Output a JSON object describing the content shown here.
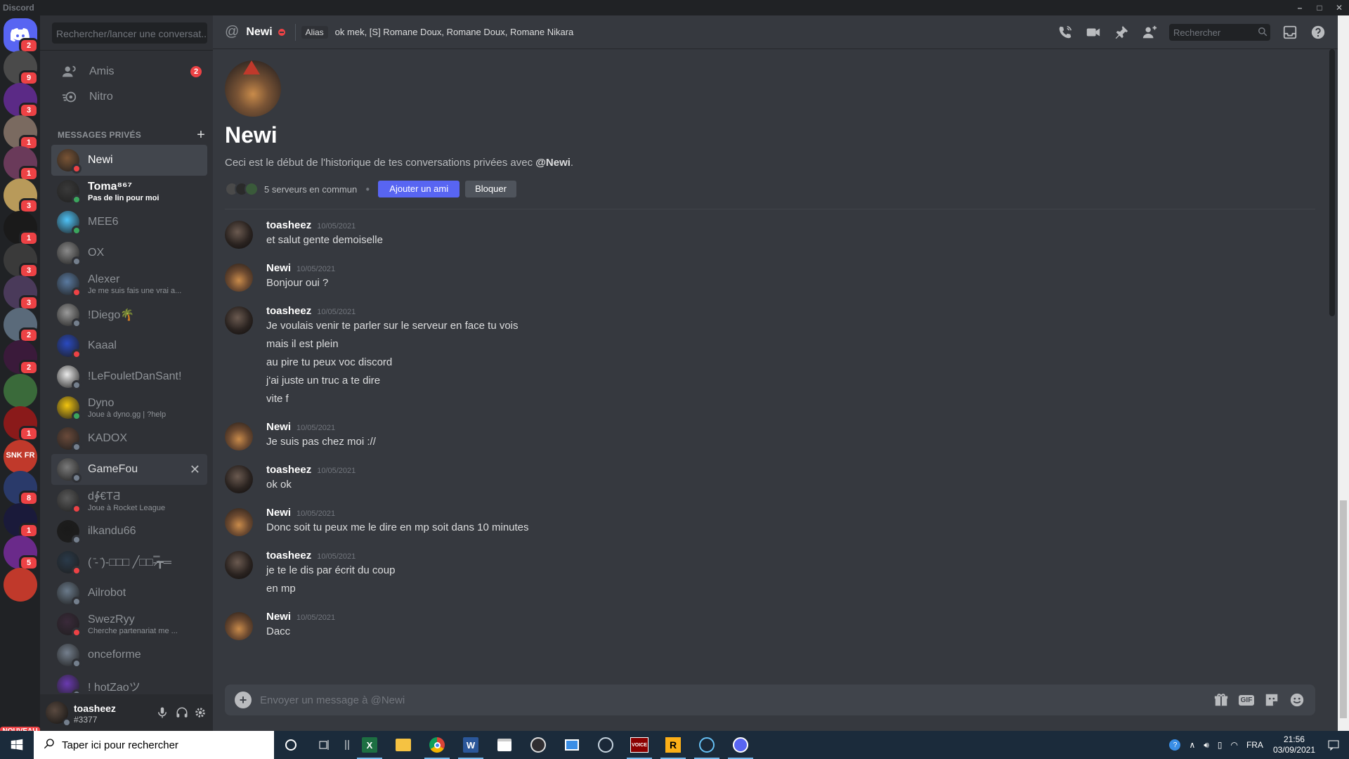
{
  "window": {
    "title": "Discord"
  },
  "servers": [
    {
      "name": "home",
      "badge": "2",
      "color": "#5865f2"
    },
    {
      "name": "server-1",
      "badge": "9",
      "color": "#4a4a4a"
    },
    {
      "name": "server-2",
      "badge": "3",
      "color": "#5b2a86"
    },
    {
      "name": "server-3",
      "badge": "1",
      "color": "#7a6a60"
    },
    {
      "name": "server-4",
      "badge": "1",
      "color": "#6a3a5a"
    },
    {
      "name": "server-5",
      "badge": "3",
      "color": "#b89a5a"
    },
    {
      "name": "server-6",
      "badge": "1",
      "color": "#1a1a1a"
    },
    {
      "name": "server-7",
      "badge": "3",
      "color": "#3a3a3a"
    },
    {
      "name": "server-8",
      "badge": "3",
      "color": "#4a3a5a"
    },
    {
      "name": "server-9",
      "badge": "2",
      "color": "#5a6a7a"
    },
    {
      "name": "server-10",
      "badge": "2",
      "color": "#3a1a3a"
    },
    {
      "name": "server-11",
      "badge": "",
      "color": "#3a6a3a"
    },
    {
      "name": "server-12",
      "badge": "1",
      "color": "#8a1a1a"
    },
    {
      "name": "server-13",
      "badge": "",
      "color": "#c0392b",
      "label": "SNK FR"
    },
    {
      "name": "server-14",
      "badge": "8",
      "color": "#2a3a6a"
    },
    {
      "name": "server-15",
      "badge": "1",
      "color": "#1a1a3a"
    },
    {
      "name": "server-16",
      "badge": "5",
      "color": "#6a2a8a"
    },
    {
      "name": "server-17",
      "badge": "",
      "color": "#c0392b"
    }
  ],
  "new_label": "NOUVEAU",
  "sidebar": {
    "search_placeholder": "Rechercher/lancer une conversat...",
    "friends": {
      "label": "Amis",
      "count": "2"
    },
    "nitro": {
      "label": "Nitro"
    },
    "dm_header": "MESSAGES PRIVÉS",
    "dms": [
      {
        "name": "Newi",
        "sub": "",
        "status": "dnd",
        "color": "#7a5435",
        "active": true
      },
      {
        "name": "Toma⁸⁶⁷",
        "sub": "Pas de lin pour moi",
        "status": "online",
        "color": "#3a3a3a",
        "bold": true
      },
      {
        "name": "MEE6",
        "sub": "",
        "status": "online",
        "color": "#4fc3f7"
      },
      {
        "name": "OX",
        "sub": "",
        "status": "offline",
        "color": "#8a8a8a"
      },
      {
        "name": "Alexer",
        "sub": "Je me suis fais une vrai a...",
        "status": "dnd",
        "color": "#5a7aa0"
      },
      {
        "name": "!Diego🌴",
        "sub": "",
        "status": "offline",
        "color": "#9a9a9a"
      },
      {
        "name": "Kaaal",
        "sub": "",
        "status": "dnd",
        "color": "#2a4ac0"
      },
      {
        "name": "!LeFouletDanSant!",
        "sub": "",
        "status": "offline",
        "color": "#eaeaea"
      },
      {
        "name": "Dyno",
        "sub": "Joue à dyno.gg | ?help",
        "status": "online",
        "color": "#f1c40f"
      },
      {
        "name": "KADOX",
        "sub": "",
        "status": "offline",
        "color": "#6a4a3a"
      },
      {
        "name": "GameFou",
        "sub": "",
        "status": "offline",
        "color": "#7a7a7a",
        "hover": true
      },
      {
        "name": "d∳€ΤƋ",
        "sub": "Joue à Rocket League",
        "status": "dnd",
        "color": "#5a5a5a"
      },
      {
        "name": "ilkandu66",
        "sub": "",
        "status": "offline",
        "color": "#1a1a1a"
      },
      {
        "name": "( ̄- ̄)-□□□ ╱□□-̷̿┳═",
        "sub": "",
        "status": "dnd",
        "color": "#2a3a4a"
      },
      {
        "name": "Ailrobot",
        "sub": "",
        "status": "offline",
        "color": "#6a7a8a"
      },
      {
        "name": "SwezRyy",
        "sub": "Cherche partenariat me ...",
        "status": "dnd",
        "color": "#3a2a3a"
      },
      {
        "name": "onceforme",
        "sub": "",
        "status": "offline",
        "color": "#747f8d"
      },
      {
        "name": "! hotZaoツ",
        "sub": "",
        "status": "offline",
        "color": "#6a3ab0"
      }
    ],
    "user": {
      "name": "toasheez",
      "tag": "#3377"
    }
  },
  "header": {
    "channel": "Newi",
    "alias_tag": "Alias",
    "alias_names": "ok mek, [S] Romane Doux, Romane Doux, Romane Nikara",
    "search_placeholder": "Rechercher"
  },
  "welcome": {
    "title": "Newi",
    "subtitle_prefix": "Ceci est le début de l'historique de tes conversations privées avec ",
    "subtitle_mention": "@Newi",
    "subtitle_suffix": ".",
    "mutual": "5 serveurs en commun",
    "add_friend": "Ajouter un ami",
    "block": "Bloquer"
  },
  "messages": [
    {
      "author": "toasheez",
      "time": "10/05/2021",
      "av": "toa",
      "lines": [
        "et salut gente demoiselle"
      ]
    },
    {
      "author": "Newi",
      "time": "10/05/2021",
      "av": "newi",
      "lines": [
        "Bonjour oui ?"
      ]
    },
    {
      "author": "toasheez",
      "time": "10/05/2021",
      "av": "toa",
      "lines": [
        "Je voulais venir te parler sur le serveur en face tu vois",
        "mais il est plein",
        "au pire tu peux voc discord",
        "j'ai juste un truc a te dire",
        "vite f"
      ]
    },
    {
      "author": "Newi",
      "time": "10/05/2021",
      "av": "newi",
      "lines": [
        "Je suis pas chez moi ://"
      ]
    },
    {
      "author": "toasheez",
      "time": "10/05/2021",
      "av": "toa",
      "lines": [
        "ok ok"
      ]
    },
    {
      "author": "Newi",
      "time": "10/05/2021",
      "av": "newi",
      "lines": [
        "Donc soit tu peux me le dire en mp soit dans 10 minutes"
      ]
    },
    {
      "author": "toasheez",
      "time": "10/05/2021",
      "av": "toa",
      "lines": [
        "je te le dis par écrit du coup",
        "en mp"
      ]
    },
    {
      "author": "Newi",
      "time": "10/05/2021",
      "av": "newi",
      "lines": [
        "Dacc"
      ]
    }
  ],
  "composer": {
    "placeholder": "Envoyer un message à @Newi",
    "gif": "GIF"
  },
  "taskbar": {
    "search_placeholder": "Taper ici pour rechercher",
    "lang": "FRA",
    "time": "21:56",
    "date": "03/09/2021"
  }
}
